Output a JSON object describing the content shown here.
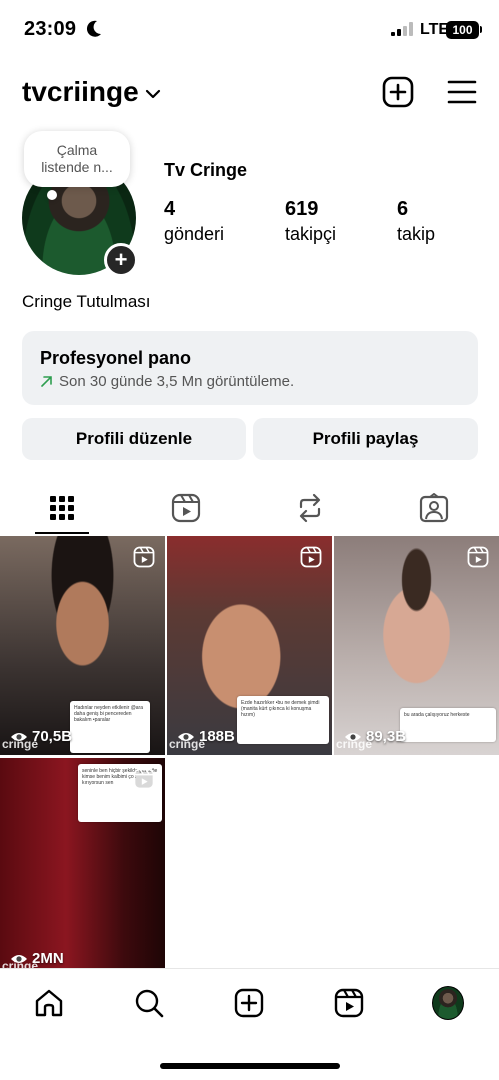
{
  "status_bar": {
    "time": "23:09",
    "network": "LTE",
    "battery": "100"
  },
  "header": {
    "username": "tvcriinge"
  },
  "profile": {
    "note": "Çalma listende n...",
    "display_name": "Tv Cringe",
    "stats": [
      {
        "value": "4",
        "label": "gönderi"
      },
      {
        "value": "619",
        "label": "takipçi"
      },
      {
        "value": "6",
        "label": "takip"
      }
    ],
    "bio": "Cringe Tutulması"
  },
  "pro_dashboard": {
    "title": "Profesyonel pano",
    "subtitle": "Son 30 günde 3,5 Mn görüntüleme.",
    "trend_color": "#2e9e4f"
  },
  "buttons": {
    "edit_profile": "Profili düzenle",
    "share_profile": "Profili paylaş"
  },
  "tabs": [
    "grid-icon",
    "reels-icon",
    "reposts-icon",
    "tagged-icon"
  ],
  "posts": [
    {
      "views": "70,5B",
      "watermark": "cringe",
      "caption": "Hadınlar neyden etkilenir @ara daha geniş bi pencereden bakalım •paralar"
    },
    {
      "views": "188B",
      "watermark": "cringe",
      "caption": "Ezde hazırlıker •bu ne demek şimdi (manita kürt çıkınca ki konuşma hızım)"
    },
    {
      "views": "89,3B",
      "watermark": "cringe",
      "caption": "bu arada çalışıyoruz herkeste"
    },
    {
      "views": "2MN",
      "watermark": "cringe",
      "caption": "seninle ben hiçbir şekilde gerçeğe kimse benim kalbimi çok kırıyorsun sen"
    }
  ],
  "bottom_nav": [
    "home-icon",
    "search-icon",
    "create-icon",
    "reels-icon",
    "profile-avatar"
  ]
}
